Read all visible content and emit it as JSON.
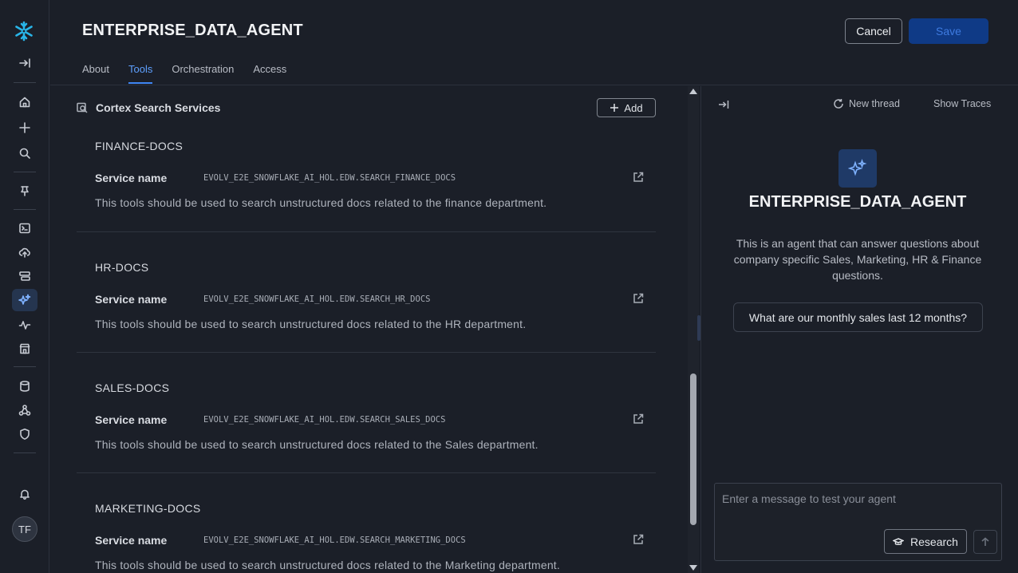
{
  "header": {
    "title": "ENTERPRISE_DATA_AGENT",
    "tabs": [
      {
        "label": "About",
        "active": false
      },
      {
        "label": "Tools",
        "active": true
      },
      {
        "label": "Orchestration",
        "active": false
      },
      {
        "label": "Access",
        "active": false
      }
    ],
    "cancel_label": "Cancel",
    "save_label": "Save"
  },
  "sidebar": {
    "icons": [
      "snowflake-logo",
      "expand-icon",
      "home-icon",
      "plus-icon",
      "search-icon",
      "pin-icon",
      "terminal-icon",
      "cloud-upload-icon",
      "data-icon",
      "ai-sparkle-icon",
      "activity-icon",
      "marketplace-icon",
      "database-icon",
      "network-icon",
      "shield-icon",
      "bell-icon"
    ],
    "active": "ai-sparkle-icon",
    "avatar_initials": "TF"
  },
  "tools": {
    "section_title": "Cortex Search Services",
    "add_label": "Add",
    "services": [
      {
        "name": "FINANCE-DOCS",
        "label": "Service name",
        "service_id": "EVOLV_E2E_SNOWFLAKE_AI_HOL.EDW.SEARCH_FINANCE_DOCS",
        "description": "This tools should be used to search unstructured docs related to the finance department."
      },
      {
        "name": "HR-DOCS",
        "label": "Service name",
        "service_id": "EVOLV_E2E_SNOWFLAKE_AI_HOL.EDW.SEARCH_HR_DOCS",
        "description": "This tools should be used to search unstructured docs related to the HR department."
      },
      {
        "name": "SALES-DOCS",
        "label": "Service name",
        "service_id": "EVOLV_E2E_SNOWFLAKE_AI_HOL.EDW.SEARCH_SALES_DOCS",
        "description": "This tools should be used to search unstructured docs related to the Sales department."
      },
      {
        "name": "MARKETING-DOCS",
        "label": "Service name",
        "service_id": "EVOLV_E2E_SNOWFLAKE_AI_HOL.EDW.SEARCH_MARKETING_DOCS",
        "description": "This tools should be used to search unstructured docs related to the Marketing department."
      }
    ]
  },
  "test_panel": {
    "new_thread_label": "New thread",
    "show_traces_label": "Show Traces",
    "agent_title": "ENTERPRISE_DATA_AGENT",
    "agent_description": "This is an agent that can answer questions about company specific Sales, Marketing, HR & Finance questions.",
    "suggestion": "What are our monthly sales last 12 months?",
    "input_placeholder": "Enter a message to test your agent",
    "research_label": "Research"
  },
  "colors": {
    "background": "#1b1f28",
    "accent": "#3f86f4",
    "save_button": "#0f3a86",
    "snowflake_logo": "#29b5e8"
  }
}
